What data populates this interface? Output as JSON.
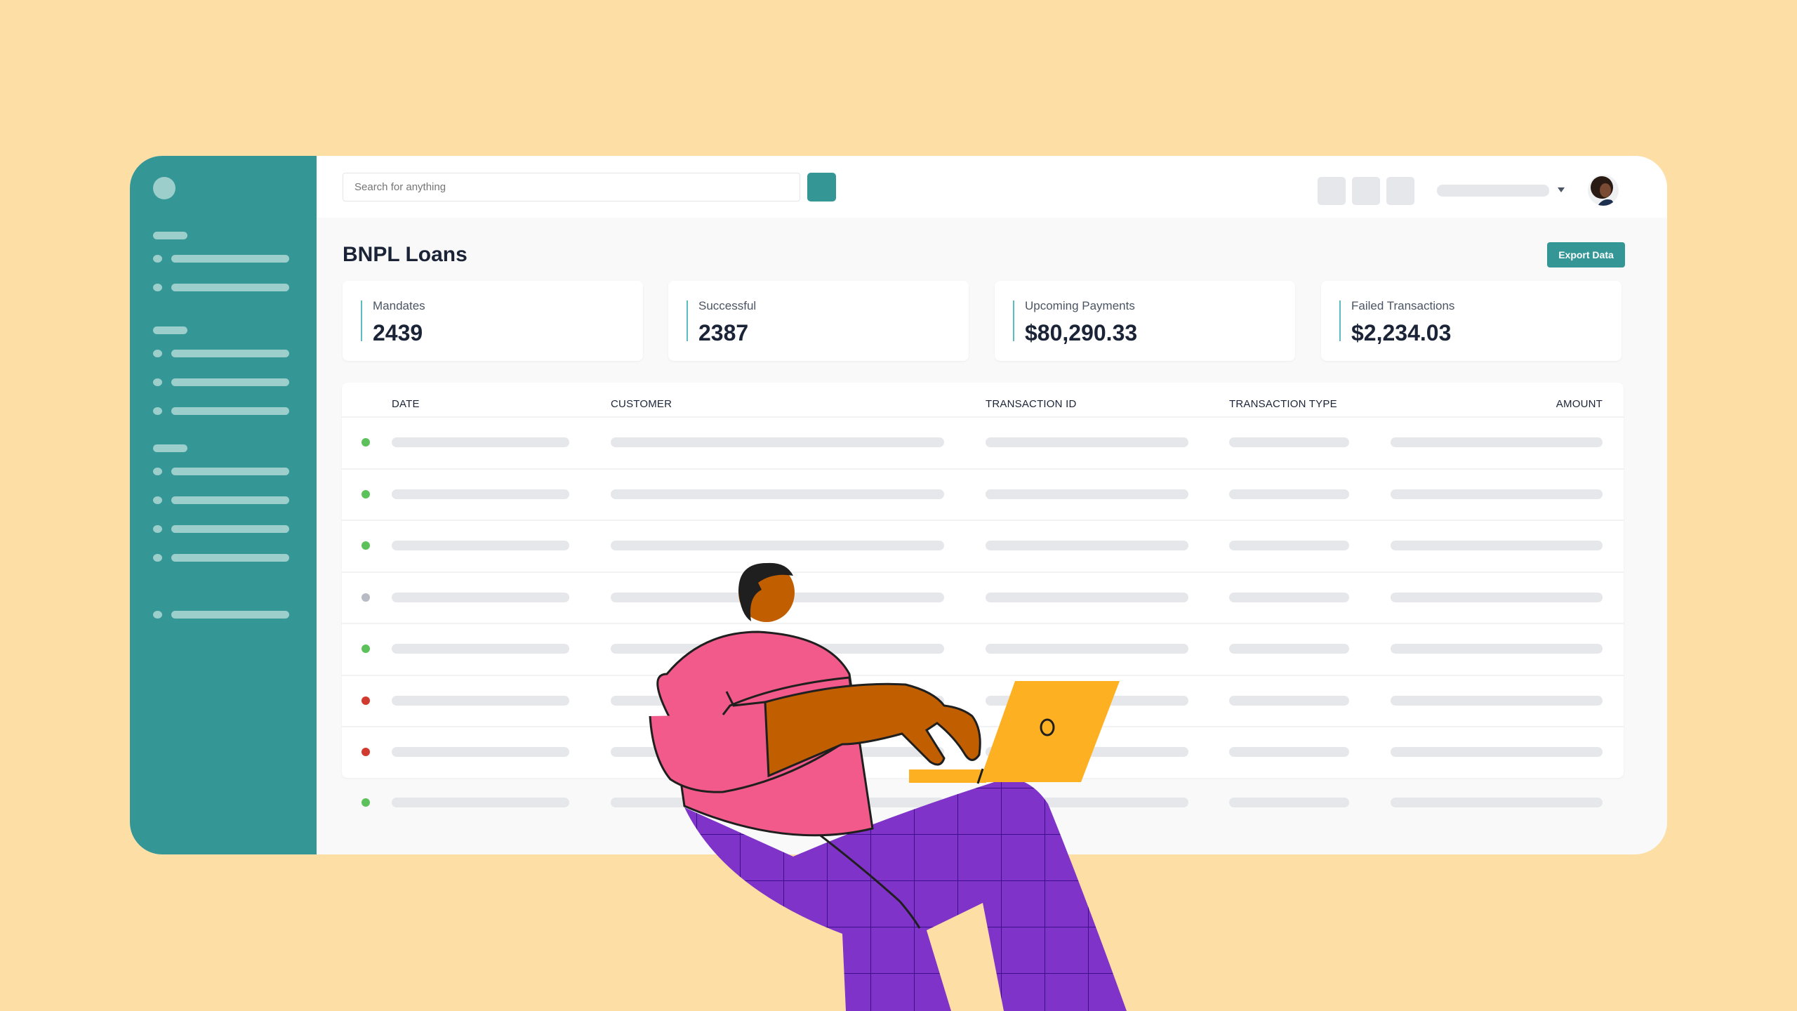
{
  "theme": {
    "background": "#fddea4",
    "accent": "#359795",
    "status_colors": {
      "success": "#5cc15a",
      "pending": "#b9bbc4",
      "failed": "#d13a2f"
    }
  },
  "sidebar": {
    "logo_icon": "app-logo-icon",
    "groups": [
      {
        "items": 2
      },
      {
        "items": 3
      },
      {
        "items": 4
      },
      {
        "items": 1
      }
    ]
  },
  "topbar": {
    "search_placeholder": "Search for anything",
    "search_button_icon": "search-icon",
    "icon_buttons": [
      "toolbar-button-1",
      "toolbar-button-2",
      "toolbar-button-3"
    ],
    "account_dropdown_icon": "caret-down-icon",
    "avatar": "user-avatar"
  },
  "page": {
    "title": "BNPL Loans",
    "export_label": "Export Data"
  },
  "stats": [
    {
      "label": "Mandates",
      "value": "2439"
    },
    {
      "label": "Successful",
      "value": "2387"
    },
    {
      "label": "Upcoming Payments",
      "value": "$80,290.33"
    },
    {
      "label": "Failed Transactions",
      "value": "$2,234.03"
    }
  ],
  "table": {
    "columns": [
      "DATE",
      "CUSTOMER",
      "TRANSACTION ID",
      "TRANSACTION TYPE",
      "AMOUNT"
    ],
    "rows": [
      {
        "status": "success"
      },
      {
        "status": "success"
      },
      {
        "status": "success"
      },
      {
        "status": "pending"
      },
      {
        "status": "success"
      },
      {
        "status": "failed"
      },
      {
        "status": "failed"
      },
      {
        "status": "success"
      }
    ]
  },
  "illustration": {
    "subject": "person-typing-on-laptop",
    "colors": {
      "shirt": "#f15a8a",
      "skin": "#c15e00",
      "pants": "#8033c9",
      "laptop": "#fdb022",
      "hair": "#1f1f1f"
    }
  }
}
